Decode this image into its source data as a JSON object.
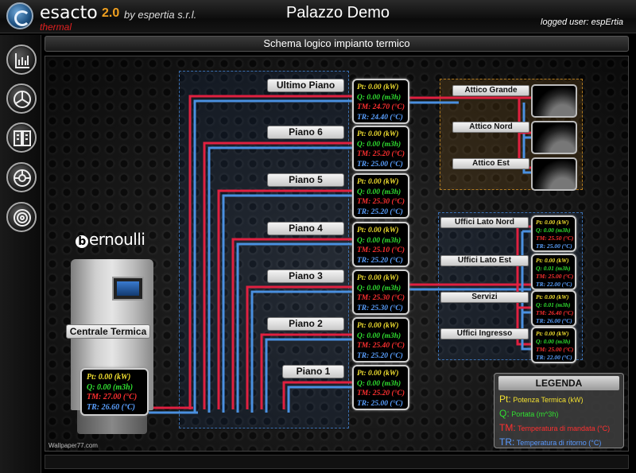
{
  "header": {
    "app_name": "esacto",
    "version": "2.0",
    "by": "by espertia s.r.l.",
    "subtitle": "thermal",
    "title": "Palazzo Demo",
    "logged_user": "logged user: espErtia"
  },
  "subheader": {
    "title": "Schema logico impianto termico"
  },
  "toolbar": [
    "chart-bars-icon",
    "fan-icon",
    "panel-icon",
    "pump-icon",
    "valve-icon"
  ],
  "plant": {
    "brand": "ernoulli",
    "brand_initial": "b",
    "label": "Centrale Termica",
    "readings": {
      "pt": "Pt: 0.00 (kW)",
      "q": "Q: 0.00 (m3h)",
      "tm": "TM: 27.00 (°C)",
      "tr": "TR: 26.60 (°C)"
    }
  },
  "floors": [
    {
      "name": "Ultimo Piano",
      "pt": "Pt: 0.00 (kW)",
      "q": "Q: 0.00 (m3h)",
      "tm": "TM: 24.70 (°C)",
      "tr": "TR: 24.40 (°C)"
    },
    {
      "name": "Piano 6",
      "pt": "Pt: 0.00 (kW)",
      "q": "Q: 0.00 (m3h)",
      "tm": "TM: 25.20 (°C)",
      "tr": "TR: 25.00 (°C)"
    },
    {
      "name": "Piano 5",
      "pt": "Pt: 0.00 (kW)",
      "q": "Q: 0.00 (m3h)",
      "tm": "TM: 25.30 (°C)",
      "tr": "TR: 25.20 (°C)"
    },
    {
      "name": "Piano 4",
      "pt": "Pt: 0.00 (kW)",
      "q": "Q: 0.00 (m3h)",
      "tm": "TM: 25.10 (°C)",
      "tr": "TR: 25.20 (°C)"
    },
    {
      "name": "Piano 3",
      "pt": "Pt: 0.00 (kW)",
      "q": "Q: 0.00 (m3h)",
      "tm": "TM: 25.30 (°C)",
      "tr": "TR: 25.30 (°C)"
    },
    {
      "name": "Piano 2",
      "pt": "Pt: 0.00 (kW)",
      "q": "Q: 0.00 (m3h)",
      "tm": "TM: 25.40 (°C)",
      "tr": "TR: 25.20 (°C)"
    },
    {
      "name": "Piano 1",
      "pt": "Pt: 0.00 (kW)",
      "q": "Q: 0.00 (m3h)",
      "tm": "TM: 25.20 (°C)",
      "tr": "TR: 25.00 (°C)"
    }
  ],
  "attico": [
    {
      "name": "Attico Grande"
    },
    {
      "name": "Attico Nord"
    },
    {
      "name": "Attico Est"
    }
  ],
  "uffici": [
    {
      "name": "Uffici Lato Nord",
      "pt": "Pt: 0.00 (kW)",
      "q": "Q: 0.00 (m3h)",
      "tm": "TM: 25.50 (°C)",
      "tr": "TR: 25.00 (°C)"
    },
    {
      "name": "Uffici Lato Est",
      "pt": "Pt: 0.00 (kW)",
      "q": "Q: 0.01 (m3h)",
      "tm": "TM: 25.00 (°C)",
      "tr": "TR: 22.00 (°C)"
    },
    {
      "name": "Servizi",
      "pt": "Pt: 0.00 (kW)",
      "q": "Q: 0.01 (m3h)",
      "tm": "TM: 26.40 (°C)",
      "tr": "TR: 26.00 (°C)"
    },
    {
      "name": "Uffici Ingresso",
      "pt": "Pt: 0.00 (kW)",
      "q": "Q: 0.00 (m3h)",
      "tm": "TM: 25.00 (°C)",
      "tr": "TR: 22.00 (°C)"
    }
  ],
  "legend": {
    "title": "LEGENDA",
    "pt_key": "Pt:",
    "pt_text": "Potenza Termica  (kW)",
    "q_key": "Q:",
    "q_text": "Portata (m^3h)",
    "tm_key": "TM:",
    "tm_text": "Temperatura di mandata (°C)",
    "tr_key": "TR:",
    "tr_text": "Temperatura di ritorno (°C)"
  },
  "watermark": "Wallpaper77.com",
  "colors": {
    "supply": "#e02040",
    "return": "#4a90e0",
    "accent": "#f0a020"
  }
}
